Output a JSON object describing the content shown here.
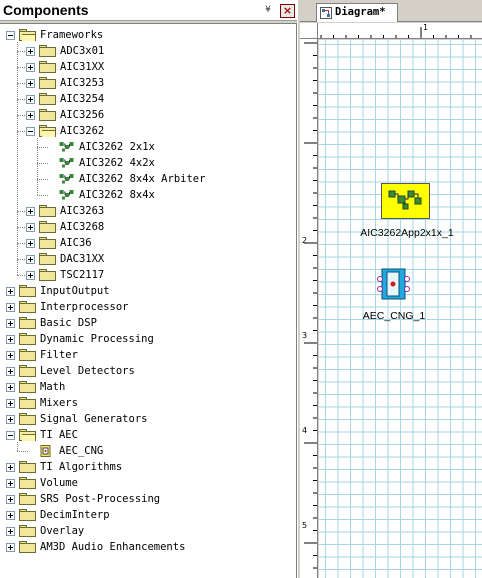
{
  "components_panel": {
    "title": "Components",
    "collapse_glyph": "¥",
    "close_glyph": "×",
    "tree": [
      {
        "label": "Frameworks",
        "depth": 0,
        "expanded": true,
        "type": "folder"
      },
      {
        "label": "ADC3x01",
        "depth": 1,
        "expanded": false,
        "type": "folder"
      },
      {
        "label": "AIC31XX",
        "depth": 1,
        "expanded": false,
        "type": "folder"
      },
      {
        "label": "AIC3253",
        "depth": 1,
        "expanded": false,
        "type": "folder"
      },
      {
        "label": "AIC3254",
        "depth": 1,
        "expanded": false,
        "type": "folder"
      },
      {
        "label": "AIC3256",
        "depth": 1,
        "expanded": false,
        "type": "folder"
      },
      {
        "label": "AIC3262",
        "depth": 1,
        "expanded": true,
        "type": "folder"
      },
      {
        "label": "AIC3262 2x1x",
        "depth": 2,
        "type": "leaf"
      },
      {
        "label": "AIC3262 4x2x",
        "depth": 2,
        "type": "leaf"
      },
      {
        "label": "AIC3262 8x4x Arbiter",
        "depth": 2,
        "type": "leaf"
      },
      {
        "label": "AIC3262 8x4x",
        "depth": 2,
        "type": "leaf"
      },
      {
        "label": "AIC3263",
        "depth": 1,
        "expanded": false,
        "type": "folder"
      },
      {
        "label": "AIC3268",
        "depth": 1,
        "expanded": false,
        "type": "folder"
      },
      {
        "label": "AIC36",
        "depth": 1,
        "expanded": false,
        "type": "folder"
      },
      {
        "label": "DAC31XX",
        "depth": 1,
        "expanded": false,
        "type": "folder"
      },
      {
        "label": "TSC2117",
        "depth": 1,
        "expanded": false,
        "type": "folder"
      },
      {
        "label": "InputOutput",
        "depth": 0,
        "expanded": false,
        "type": "folder"
      },
      {
        "label": "Interprocessor",
        "depth": 0,
        "expanded": false,
        "type": "folder"
      },
      {
        "label": "Basic DSP",
        "depth": 0,
        "expanded": false,
        "type": "folder"
      },
      {
        "label": "Dynamic Processing",
        "depth": 0,
        "expanded": false,
        "type": "folder"
      },
      {
        "label": "Filter",
        "depth": 0,
        "expanded": false,
        "type": "folder"
      },
      {
        "label": "Level Detectors",
        "depth": 0,
        "expanded": false,
        "type": "folder"
      },
      {
        "label": "Math",
        "depth": 0,
        "expanded": false,
        "type": "folder"
      },
      {
        "label": "Mixers",
        "depth": 0,
        "expanded": false,
        "type": "folder"
      },
      {
        "label": "Signal Generators",
        "depth": 0,
        "expanded": false,
        "type": "folder"
      },
      {
        "label": "TI AEC",
        "depth": 0,
        "expanded": true,
        "type": "folder"
      },
      {
        "label": "AEC_CNG",
        "depth": 1,
        "type": "leaf-aec"
      },
      {
        "label": "TI Algorithms",
        "depth": 0,
        "expanded": false,
        "type": "folder"
      },
      {
        "label": "Volume",
        "depth": 0,
        "expanded": false,
        "type": "folder"
      },
      {
        "label": "SRS Post-Processing",
        "depth": 0,
        "expanded": false,
        "type": "folder"
      },
      {
        "label": "DecimInterp",
        "depth": 0,
        "expanded": false,
        "type": "folder"
      },
      {
        "label": "Overlay",
        "depth": 0,
        "expanded": false,
        "type": "folder"
      },
      {
        "label": "AM3D Audio Enhancements",
        "depth": 0,
        "expanded": false,
        "type": "folder"
      }
    ]
  },
  "diagram": {
    "tab_label": "Diagram*",
    "ruler_top_labels": [
      "1"
    ],
    "ruler_left_labels": [
      "2",
      "3",
      "4",
      "5"
    ],
    "blocks": [
      {
        "label": "AIC3262App2x1x_1",
        "kind": "framework",
        "color": "#ffff00"
      },
      {
        "label": "AEC_CNG_1",
        "kind": "aec",
        "color": "#1fa9e0"
      }
    ]
  },
  "colors": {
    "grid": "#a9d6e3",
    "folder": "#f0e79a",
    "framework_block": "#ffff00",
    "aec_block": "#1fa9e0"
  }
}
